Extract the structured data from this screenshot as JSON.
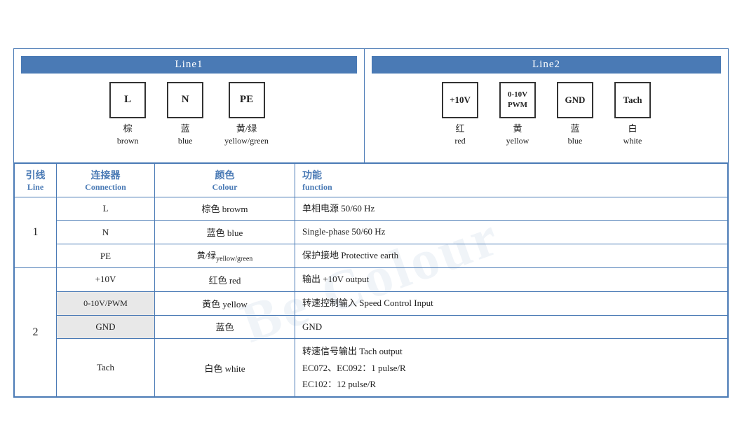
{
  "diagram": {
    "line1_header": "Line1",
    "line2_header": "Line2",
    "line1_connectors": [
      {
        "label": "L",
        "zh": "棕",
        "en": "brown"
      },
      {
        "label": "N",
        "zh": "蓝",
        "en": "blue"
      },
      {
        "label": "PE",
        "zh": "黄/绿",
        "en": "yellow/green"
      }
    ],
    "line2_connectors": [
      {
        "label": "+10V",
        "zh": "红",
        "en": "red"
      },
      {
        "label": "0-10V\nPWM",
        "zh": "黄",
        "en": "yellow"
      },
      {
        "label": "GND",
        "zh": "蓝",
        "en": "blue"
      },
      {
        "label": "Tach",
        "zh": "白",
        "en": "white"
      }
    ]
  },
  "table": {
    "headers": {
      "line_zh": "引线",
      "line_en": "Line",
      "conn_zh": "连接器",
      "conn_en": "Connection",
      "colour_zh": "颜色",
      "colour_en": "Colour",
      "func_zh": "功能",
      "func_en": "function"
    },
    "rows": [
      {
        "line": "1",
        "rowspan": 3,
        "entries": [
          {
            "conn": "L",
            "colour": "棕色 browm",
            "func": "单相电源 50/60 Hz"
          },
          {
            "conn": "N",
            "colour": "蓝色 blue",
            "func": "Single-phase 50/60 Hz"
          },
          {
            "conn": "PE",
            "colour": "黄/绿 yellow/green",
            "func": "保护接地 Protective earth"
          }
        ]
      },
      {
        "line": "2",
        "rowspan": 4,
        "entries": [
          {
            "conn": "+10V",
            "colour": "红色 red",
            "func": "输出 +10V output"
          },
          {
            "conn": "0-10V/PWM",
            "colour": "黄色 yellow",
            "func": "转速控制输入 Speed Control Input"
          },
          {
            "conn": "GND",
            "colour": "蓝色",
            "func": "GND"
          },
          {
            "conn": "Tach",
            "colour": "白色 white",
            "func": "转速信号输出 Tach output\nEC072、EC092：1 pulse/R\nEC102：12 pulse/R"
          }
        ]
      }
    ]
  },
  "watermark": "Be Colour"
}
